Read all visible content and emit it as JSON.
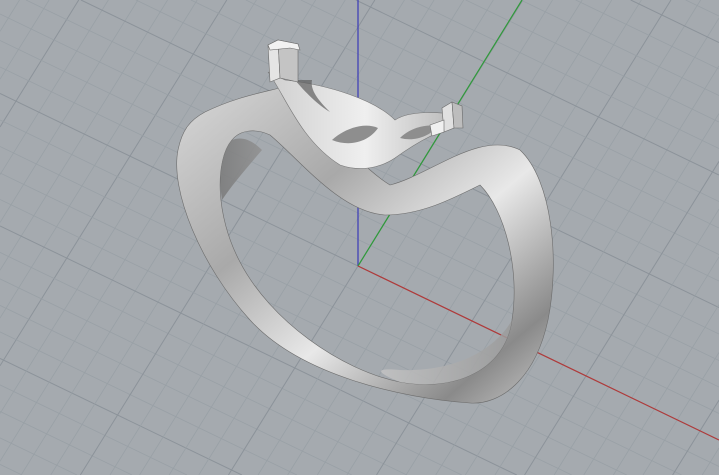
{
  "viewport": {
    "view": "perspective",
    "object": "ring",
    "colors": {
      "background": "#a5aaaf",
      "grid_minor": "#99a0a6",
      "grid_major": "#8c939a",
      "x_axis": "#b03a3a",
      "y_axis": "#2f9a3a",
      "z_axis": "#3a3ab8",
      "ring_light": "#e6e6e6",
      "ring_mid": "#bdbdbd",
      "ring_dark": "#6f6f6f"
    }
  }
}
